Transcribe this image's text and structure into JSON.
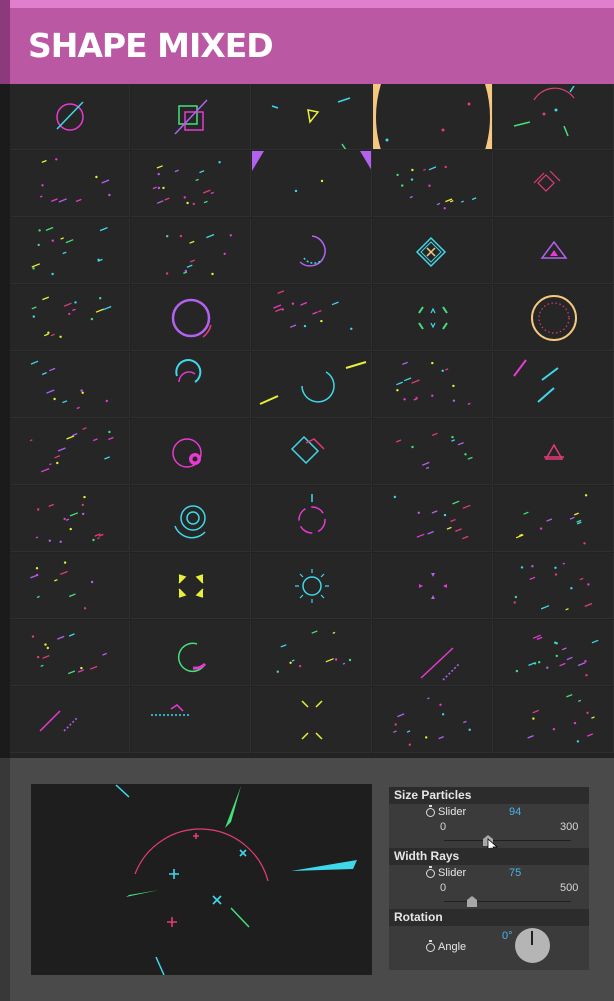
{
  "header": {
    "title": "SHAPE MIXED"
  },
  "grid": {
    "columns": 5,
    "rows": 10
  },
  "controls": {
    "size_particles": {
      "section": "Size Particles",
      "type": "Slider",
      "value": "94",
      "min": "0",
      "max": "300"
    },
    "width_rays": {
      "section": "Width Rays",
      "type": "Slider",
      "value": "75",
      "min": "0",
      "max": "500"
    },
    "rotation": {
      "section": "Rotation",
      "type": "Angle",
      "value": "0°"
    }
  },
  "colors": {
    "header": "#bb58a4",
    "accent_blue": "#4ab3e8",
    "cyan": "#3fd8e8",
    "magenta": "#e63ad0",
    "pink": "#e23b7a",
    "yellow": "#e8f03a",
    "green": "#44e07a",
    "purple": "#b362f0"
  },
  "icons": [
    "stopwatch-icon",
    "mouse-cursor-icon",
    "angle-dial-icon"
  ]
}
